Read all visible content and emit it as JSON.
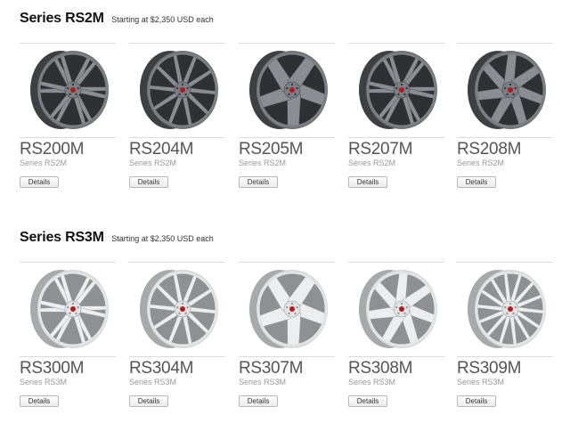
{
  "sections": [
    {
      "title": "Series RS2M",
      "subtitle": "Starting at $2,350 USD each",
      "finish": "dark",
      "wheels": [
        {
          "model": "RS200M",
          "series": "Series RS2M",
          "details_label": "Details",
          "spoke_style": "split"
        },
        {
          "model": "RS204M",
          "series": "Series RS2M",
          "details_label": "Details",
          "spoke_style": "split-thin"
        },
        {
          "model": "RS205M",
          "series": "Series RS2M",
          "details_label": "Details",
          "spoke_style": "five"
        },
        {
          "model": "RS207M",
          "series": "Series RS2M",
          "details_label": "Details",
          "spoke_style": "split"
        },
        {
          "model": "RS208M",
          "series": "Series RS2M",
          "details_label": "Details",
          "spoke_style": "seven"
        }
      ]
    },
    {
      "title": "Series RS3M",
      "subtitle": "Starting at $2,350 USD each",
      "finish": "silver",
      "wheels": [
        {
          "model": "RS300M",
          "series": "Series RS3M",
          "details_label": "Details",
          "spoke_style": "split"
        },
        {
          "model": "RS304M",
          "series": "Series RS3M",
          "details_label": "Details",
          "spoke_style": "split-thin"
        },
        {
          "model": "RS307M",
          "series": "Series RS3M",
          "details_label": "Details",
          "spoke_style": "five"
        },
        {
          "model": "RS308M",
          "series": "Series RS3M",
          "details_label": "Details",
          "spoke_style": "seven"
        },
        {
          "model": "RS309M",
          "series": "Series RS3M",
          "details_label": "Details",
          "spoke_style": "multi"
        }
      ]
    }
  ],
  "colors": {
    "dark_finish": "#6a6d70",
    "silver_finish": "#d2d4d6",
    "divider": "#dcdcdc",
    "model_text": "#555555",
    "series_text": "#999999"
  }
}
